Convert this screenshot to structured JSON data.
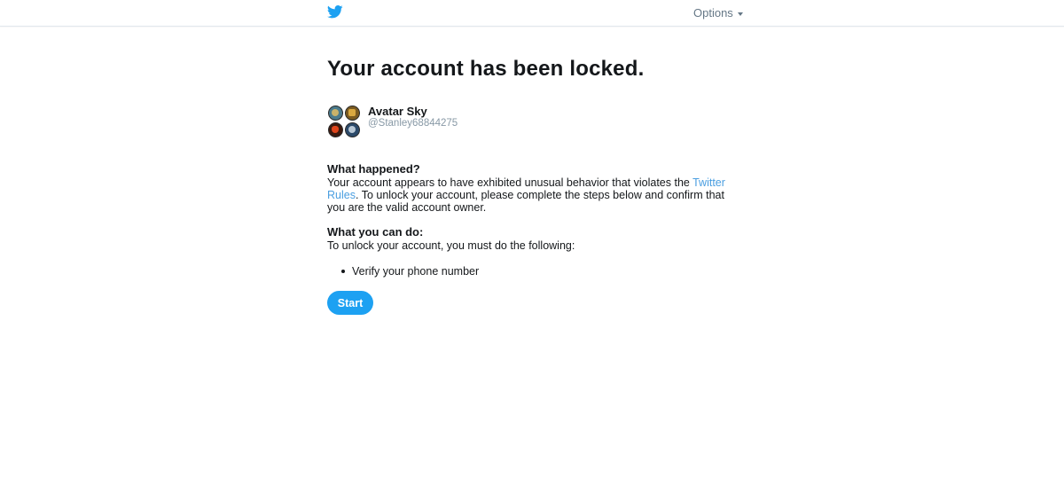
{
  "header": {
    "logo_icon": "twitter-bird-icon",
    "options_label": "Options",
    "brand_color": "#1da1f2"
  },
  "page": {
    "title": "Your account has been locked."
  },
  "user": {
    "name": "Avatar Sky",
    "handle": "@Stanley68844275",
    "avatar": "avatar-collage"
  },
  "what_happened": {
    "heading": "What happened?",
    "text_before_link": "Your account appears to have exhibited unusual behavior that violates the ",
    "link_text": "Twitter Rules",
    "text_after_link": ". To unlock your account, please complete the steps below and confirm that you are the valid account owner."
  },
  "what_you_can_do": {
    "heading": "What you can do:",
    "intro": "To unlock your account, you must do the following:",
    "steps": [
      "Verify your phone number"
    ]
  },
  "actions": {
    "start_label": "Start"
  }
}
